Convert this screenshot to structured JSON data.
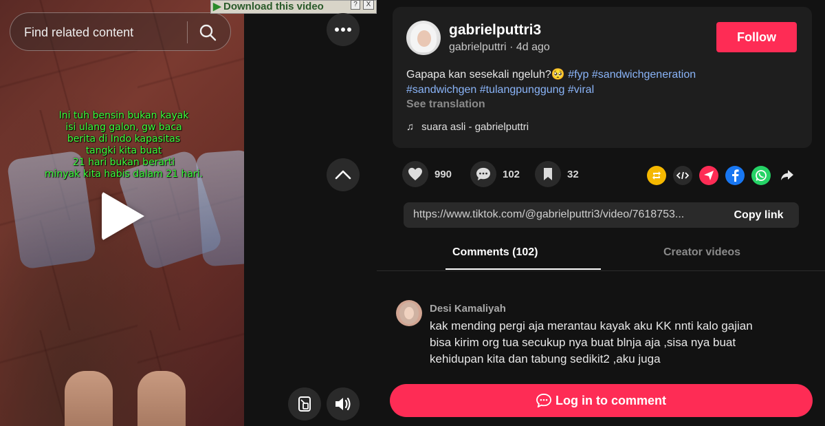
{
  "search": {
    "placeholder": "Find related content"
  },
  "video": {
    "overlay_text": "Ini tuh bensin bukan kayak\nisi ulang galon, gw baca\nberita di Indo kapasitas\ntangki kita buat\n21 hari bukan berarti\nminyak kita habis dalam 21 hari."
  },
  "download_bar": {
    "label": "Download this video",
    "help": "?",
    "close": "X"
  },
  "author": {
    "display_name": "gabrielputtri3",
    "handle": "gabrielputtri",
    "separator": "·",
    "time_ago": "4d ago",
    "follow_label": "Follow"
  },
  "caption": {
    "text": "Gapapa kan sesekali ngeluh?🥺",
    "tags_line1": [
      "#fyp",
      "#sandwichgeneration"
    ],
    "tags_line2": [
      "#sandwichgen",
      "#tulangpunggung",
      "#viral"
    ],
    "see_translation": "See translation"
  },
  "music": {
    "label": "suara asli - gabrielputtri"
  },
  "actions": {
    "likes": "990",
    "comments": "102",
    "saves": "32"
  },
  "share": {
    "link": "https://www.tiktok.com/@gabrielputtri3/video/7618753...",
    "copy_label": "Copy link"
  },
  "tabs": {
    "comments": "Comments (102)",
    "creator_videos": "Creator videos"
  },
  "comments": [
    {
      "name": "Desi Kamaliyah",
      "text": "kak mending pergi aja merantau kayak aku KK nnti kalo gajian bisa kirim org tua secukup nya buat blnja aja ,sisa nya buat kehidupan kita dan tabung sedikit2 ,aku juga"
    }
  ],
  "login": {
    "label": "Log in to comment"
  },
  "colors": {
    "accent": "#fe2c55",
    "hashtag": "#8ab4f8",
    "overlay_text": "#3cff3c"
  }
}
